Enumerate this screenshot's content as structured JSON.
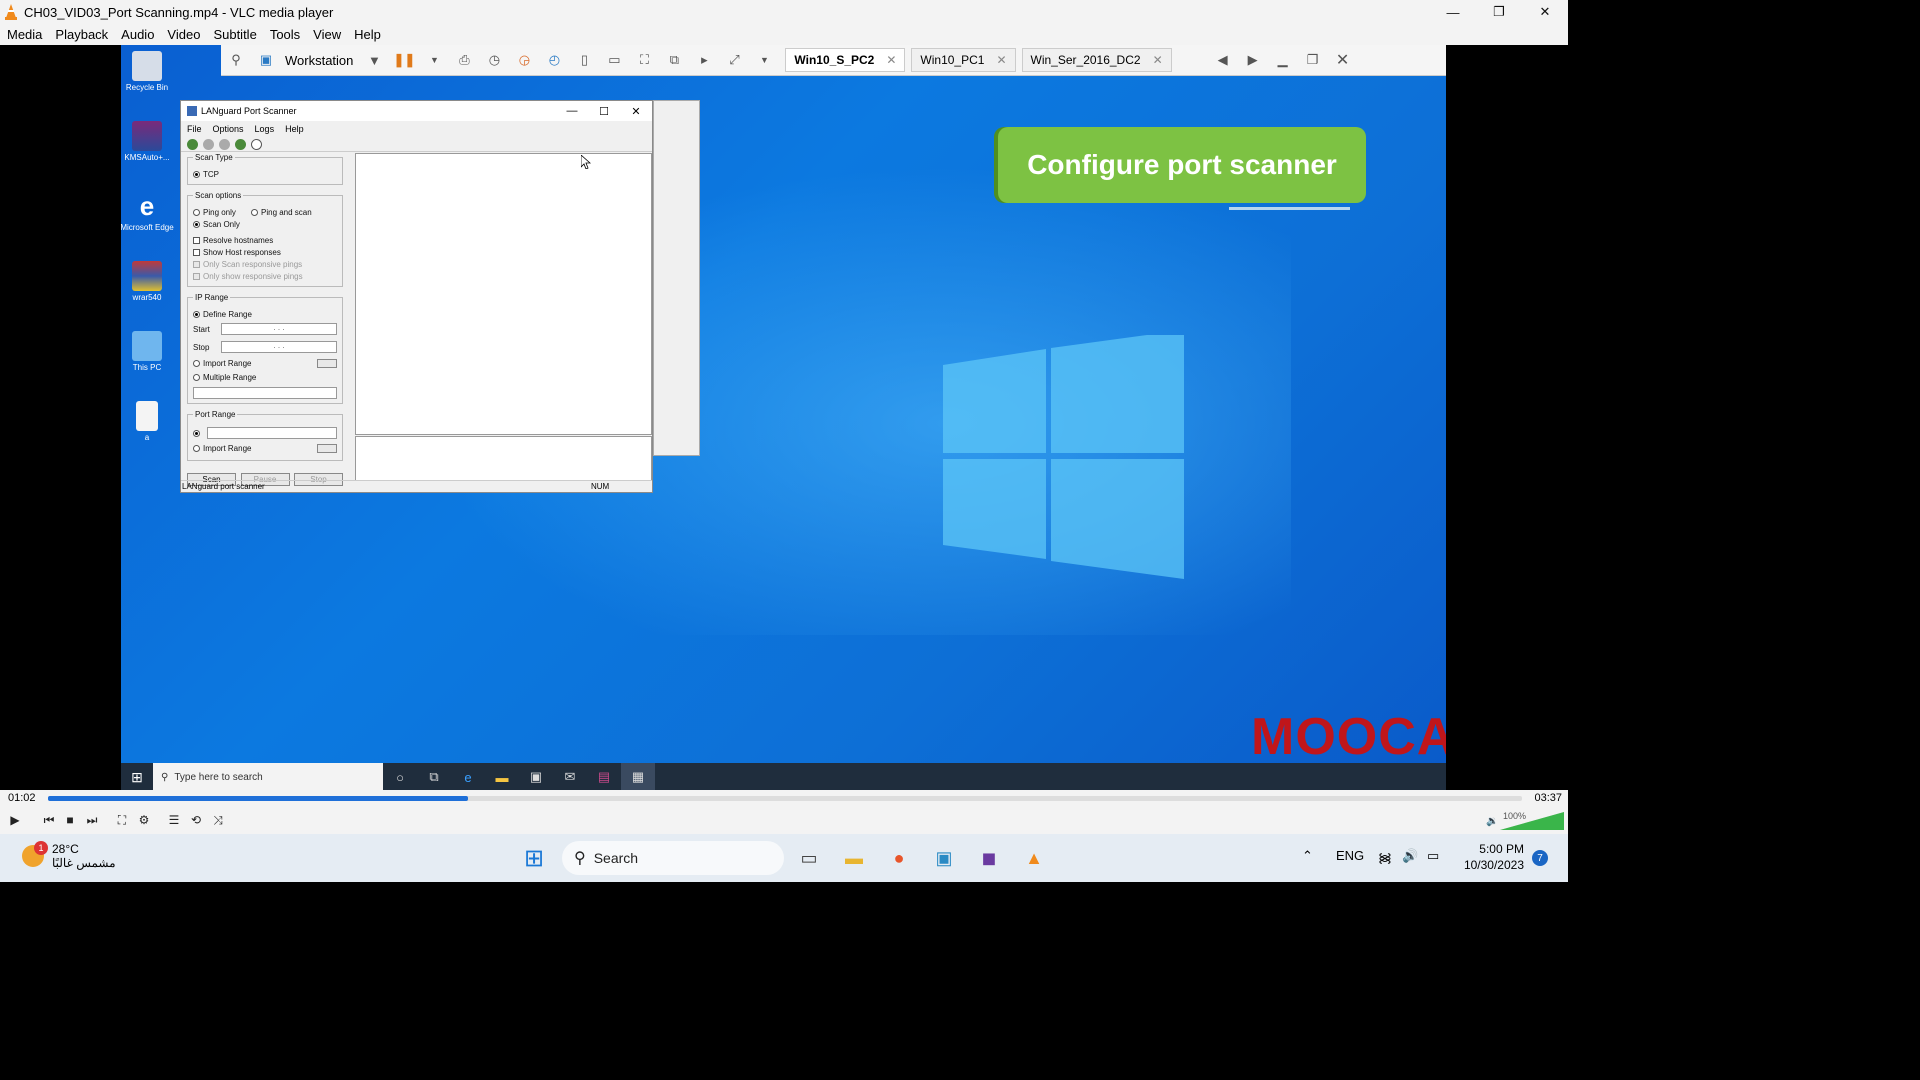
{
  "vlc": {
    "title": "CH03_VID03_Port Scanning.mp4 - VLC media player",
    "menu": [
      "Media",
      "Playback",
      "Audio",
      "Video",
      "Subtitle",
      "Tools",
      "View",
      "Help"
    ],
    "elapsed": "01:02",
    "total": "03:37",
    "progress": 0.285,
    "volume_label": "100%",
    "volume": 1.0
  },
  "vmware": {
    "workstation_label": "Workstation",
    "tabs": [
      {
        "label": "Win10_S_PC2",
        "active": true
      },
      {
        "label": "Win10_PC1",
        "active": false
      },
      {
        "label": "Win_Ser_2016_DC2",
        "active": false
      }
    ]
  },
  "desktop_icons": [
    {
      "label": "Recycle Bin",
      "icon": "recycle-bin-icon"
    },
    {
      "label": "KMSAuto+...",
      "icon": "winrar-archive-icon"
    },
    {
      "label": "Microsoft Edge",
      "icon": "edge-icon"
    },
    {
      "label": "wrar540",
      "icon": "winrar-icon"
    },
    {
      "label": "This PC",
      "icon": "computer-icon"
    },
    {
      "label": "a",
      "icon": "text-file-icon"
    }
  ],
  "banner": {
    "text": "Configure port scanner"
  },
  "watermark": {
    "text": "MOOCA"
  },
  "languard": {
    "title": "LANguard Port Scanner",
    "menu": [
      "File",
      "Options",
      "Logs",
      "Help"
    ],
    "scan_type": {
      "caption": "Scan Type",
      "option": "TCP"
    },
    "scan_options": {
      "caption": "Scan options",
      "ping_only": "Ping only",
      "ping_and_scan": "Ping and scan",
      "scan_only": "Scan Only",
      "resolve_hostnames": "Resolve hostnames",
      "show_host_responses": "Show Host responses",
      "only_scan_responsive": "Only Scan responsive pings",
      "only_show_responsive": "Only show responsive pings"
    },
    "ip_range": {
      "caption": "IP Range",
      "define_range": "Define Range",
      "start_label": "Start",
      "stop_label": "Stop",
      "start_value": ". . .",
      "stop_value": ". . .",
      "import_range": "Import Range",
      "multiple_range": "Multiple Range"
    },
    "port_range": {
      "caption": "Port Range",
      "import_range": "Import Range"
    },
    "buttons": {
      "scan": "Scan",
      "pause": "Pause",
      "stop": "Stop"
    },
    "status_text": "LANguard port scanner",
    "status_num": "NUM"
  },
  "vm_taskbar": {
    "search_placeholder": "Type here to search"
  },
  "host_taskbar": {
    "temperature": "28°C",
    "weather_text": "مشمس غالبًا",
    "weather_badge": "1",
    "search_label": "Search",
    "language": "ENG",
    "time": "5:00 PM",
    "date": "10/30/2023",
    "notification_count": "7"
  }
}
